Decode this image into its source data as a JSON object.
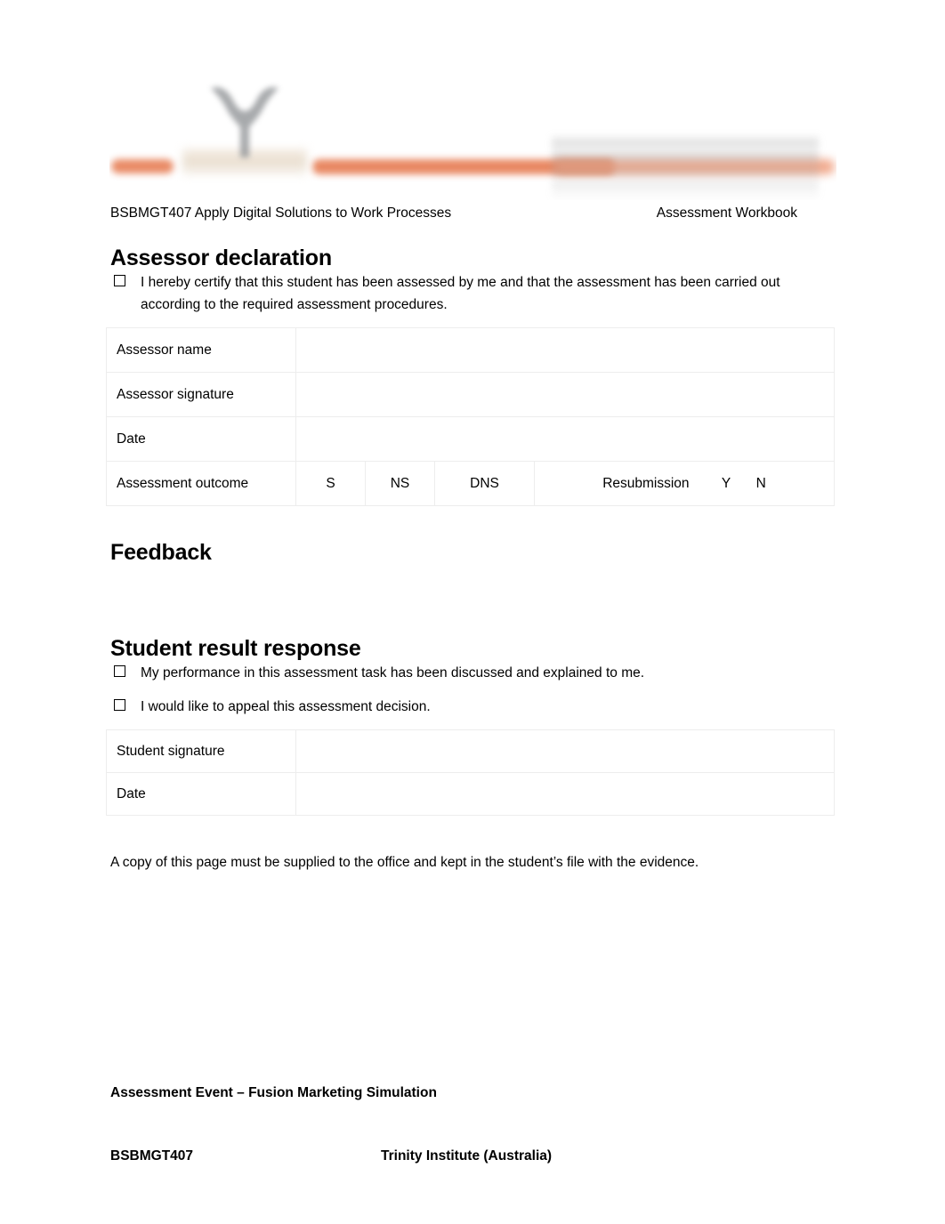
{
  "document": {
    "banner": {
      "logo_name": "trinity-institute-logo",
      "accent_color": "#e8855e"
    },
    "running_head": {
      "left": "BSBMGT407 Apply Digital Solutions to Work Processes",
      "right": "Assessment Workbook"
    },
    "assessor_declaration": {
      "heading": "Assessor declaration",
      "statement": "I hereby certify that this student has been assessed by me and that the assessment has been carried out according to the required assessment procedures.",
      "table": {
        "rows": [
          {
            "label": "Assessor name",
            "value": ""
          },
          {
            "label": "Assessor signature",
            "value": ""
          },
          {
            "label": "Date",
            "value": ""
          }
        ],
        "outcome_row": {
          "label": "Assessment outcome",
          "options": [
            "S",
            "NS",
            "DNS"
          ],
          "resubmission_label": "Resubmission",
          "resubmission_options": [
            "Y",
            "N"
          ]
        }
      }
    },
    "feedback": {
      "heading": "Feedback",
      "body": ""
    },
    "student_result_response": {
      "heading": "Student result response",
      "acknowledgements": [
        "My performance in this assessment task has been discussed and explained to me.",
        "I would like to appeal this assessment decision."
      ],
      "table": {
        "rows": [
          {
            "label": "Student signature",
            "value": ""
          },
          {
            "label": "Date",
            "value": ""
          }
        ]
      }
    },
    "copy_note": "A copy of this page must be supplied to the office and kept in the student’s file with the evidence.",
    "footer": {
      "assessment_event": "Assessment Event – Fusion Marketing Simulation",
      "unit_code": "BSBMGT407",
      "organisation": "Trinity Institute (Australia)"
    }
  }
}
